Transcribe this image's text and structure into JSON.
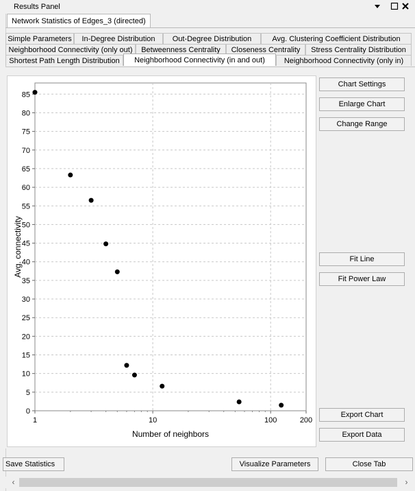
{
  "panel": {
    "title": "Results Panel",
    "menu_icon": "triangle-down-icon",
    "restore_icon": "restore-icon",
    "close_icon": "close-icon"
  },
  "outer_tab": {
    "label": "Network Statistics of Edges_3 (directed)"
  },
  "tabs": {
    "row1": [
      "Simple Parameters",
      "In-Degree Distribution",
      "Out-Degree Distribution",
      "Avg. Clustering Coefficient Distribution"
    ],
    "row2": [
      "Neighborhood Connectivity (only out)",
      "Betweenness Centrality",
      "Closeness Centrality",
      "Stress Centrality Distribution"
    ],
    "row3": [
      "Shortest Path Length Distribution",
      "Neighborhood Connectivity (in and out)",
      "Neighborhood Connectivity (only in)"
    ],
    "active": "Neighborhood Connectivity (in and out)"
  },
  "side_buttons": {
    "chart_settings": "Chart Settings",
    "enlarge_chart": "Enlarge Chart",
    "change_range": "Change Range",
    "fit_line": "Fit Line",
    "fit_power_law": "Fit Power Law",
    "export_chart": "Export Chart",
    "export_data": "Export Data"
  },
  "bottom_buttons": {
    "save_statistics": "Save Statistics",
    "visualize_parameters": "Visualize Parameters",
    "close_tab": "Close Tab"
  },
  "chart_data": {
    "type": "scatter",
    "title": "",
    "xlabel": "Number of neighbors",
    "ylabel": "Avg. connectivity",
    "x_scale": "log",
    "xlim": [
      1,
      200
    ],
    "ylim": [
      0,
      88
    ],
    "x_ticks": [
      1,
      10,
      100,
      200
    ],
    "y_ticks": [
      0,
      5,
      10,
      15,
      20,
      25,
      30,
      35,
      40,
      45,
      50,
      55,
      60,
      65,
      70,
      75,
      80,
      85
    ],
    "grid": true,
    "series": [
      {
        "x": [
          1,
          2,
          3,
          4,
          5,
          6,
          7,
          12,
          54,
          123
        ],
        "y": [
          85.5,
          63.3,
          56.5,
          44.8,
          37.3,
          12.2,
          9.6,
          6.6,
          2.4,
          1.5
        ]
      }
    ]
  }
}
